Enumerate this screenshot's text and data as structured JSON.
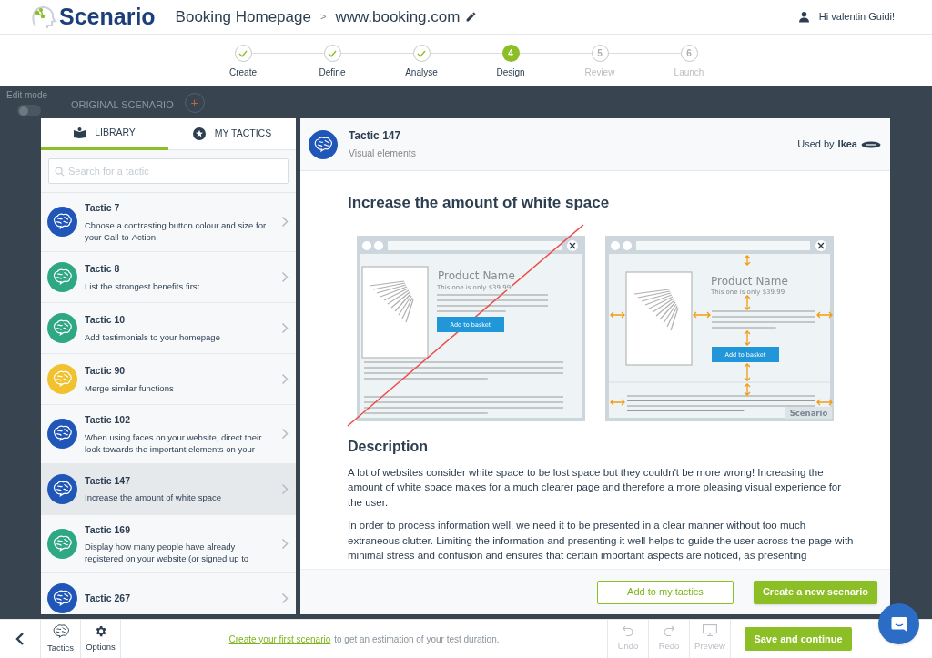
{
  "header": {
    "logo": "Scenario",
    "project": "Booking Homepage",
    "separator": ">",
    "url": "www.booking.com",
    "greeting": "Hi valentin Guidi!"
  },
  "steps": [
    {
      "label": "Create",
      "done": true,
      "selected": false
    },
    {
      "label": "Define",
      "done": true,
      "selected": false
    },
    {
      "label": "Analyse",
      "done": true,
      "selected": false
    },
    {
      "label": "Design",
      "done": false,
      "selected": true,
      "number": "4"
    },
    {
      "label": "Review",
      "done": false,
      "selected": false,
      "number": "5"
    },
    {
      "label": "Launch",
      "done": false,
      "selected": false,
      "number": "6"
    }
  ],
  "backdrop": {
    "edit_mode_label": "Edit mode",
    "edit_mode_on": false,
    "scenario": "ORIGINAL SCENARIO",
    "add_button": "+"
  },
  "library": {
    "tabs": [
      {
        "label": "LIBRARY",
        "selected": true
      },
      {
        "label": "MY TACTICS",
        "selected": false
      }
    ],
    "search": {
      "placeholder": "Search for a tactic"
    },
    "tactics": [
      {
        "title": "Tactic 7",
        "description": "Choose a contrasting button colour and size for your Call-to-Action",
        "color": "#1f56b8",
        "selected": false
      },
      {
        "title": "Tactic 8",
        "description": "List the strongest benefits first",
        "color": "#2ea883",
        "selected": false
      },
      {
        "title": "Tactic 10",
        "description": "Add testimonials to your homepage",
        "color": "#2ea883",
        "selected": false
      },
      {
        "title": "Tactic 90",
        "description": "Merge similar functions",
        "color": "#f2c12e",
        "selected": false
      },
      {
        "title": "Tactic 102",
        "description": "When using faces on your website, direct their look towards the important elements on your",
        "color": "#1f56b8",
        "selected": false
      },
      {
        "title": "Tactic 147",
        "description": "Increase the amount of white space",
        "color": "#1f56b8",
        "selected": true
      },
      {
        "title": "Tactic 169",
        "description": "Display how many people have already registered on your website (or signed up to",
        "color": "#2ea883",
        "selected": false
      },
      {
        "title": "Tactic 267",
        "color": "#1f56b8",
        "selected": false
      }
    ]
  },
  "detail": {
    "title": "Tactic 147",
    "category": "Visual elements",
    "used_by_prefix": "Used by",
    "used_by": "Ikea",
    "heading": "Increase the amount of white space",
    "illustration": {
      "before": {
        "product_name": "Product Name",
        "price": "This one is only $39.99",
        "button": "Add to basket"
      },
      "after": {
        "product_name": "Product Name",
        "price": "This one is only $39.99",
        "button": "Add to basket",
        "brand": "Scenario"
      }
    },
    "description_heading": "Description",
    "paragraphs": [
      "A lot of websites consider white space to be lost space but they couldn't be more wrong! Increasing the amount of white space makes for a much clearer page and therefore a more pleasing visual experience for the user.",
      "In order to process information well, we need it to be presented in a clear manner without too much extraneous clutter. Limiting the information and presenting it well helps to guide the user across the page with minimal stress and confusion and ensures that certain important aspects are noticed, as presenting"
    ],
    "buttons": [
      {
        "label": "Add to my tactics",
        "kind": "secondary"
      },
      {
        "label": "Create a new scenario",
        "kind": "primary"
      }
    ]
  },
  "bottom_bar": {
    "tools": [
      {
        "label": "Tactics",
        "kind": "brain"
      },
      {
        "label": "Options",
        "kind": "gear"
      }
    ],
    "hint_link": "Create your first scenario",
    "hint_text": "to get an estimation of your test duration.",
    "actions": [
      {
        "label": "Undo",
        "kind": "undo",
        "disabled": true
      },
      {
        "label": "Redo",
        "kind": "redo",
        "disabled": true
      },
      {
        "label": "Preview",
        "kind": "preview",
        "disabled": true
      }
    ],
    "save": "Save and continue"
  }
}
